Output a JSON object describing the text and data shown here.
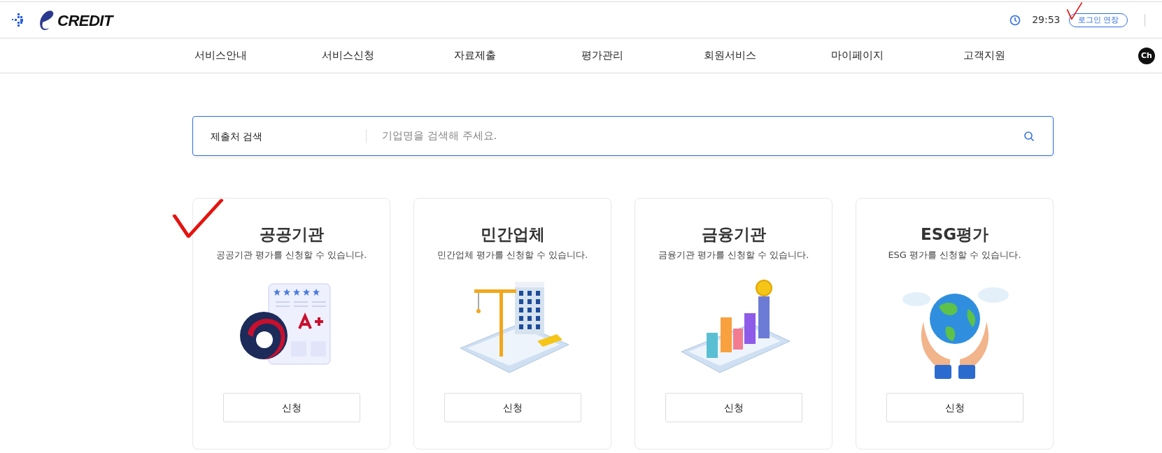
{
  "header": {
    "logo_text": "CREDIT",
    "timer": "29:53",
    "extend_button": "로그인 연장",
    "annotated": true
  },
  "nav": {
    "items": [
      "서비스안내",
      "서비스신청",
      "자료제출",
      "평가관리",
      "회원서비스",
      "마이페이지",
      "고객지원"
    ],
    "chat_badge": "Ch"
  },
  "search": {
    "label": "제출처 검색",
    "placeholder": "기업명을 검색해 주세요."
  },
  "cards": [
    {
      "kind": "public",
      "title": "공공기관",
      "description": "공공기관 평가를 신청할 수 있습니다.",
      "button": "신청",
      "annotated": true
    },
    {
      "kind": "private",
      "title": "민간업체",
      "description": "민간업체 평가를 신청할 수 있습니다.",
      "button": "신청",
      "annotated": false
    },
    {
      "kind": "finance",
      "title": "금융기관",
      "description": "금융기관 평가를 신청할 수 있습니다.",
      "button": "신청",
      "annotated": false
    },
    {
      "kind": "esg",
      "title": "ESG평가",
      "description": "ESG 평가를 신청할 수 있습니다.",
      "button": "신청",
      "annotated": false
    }
  ]
}
